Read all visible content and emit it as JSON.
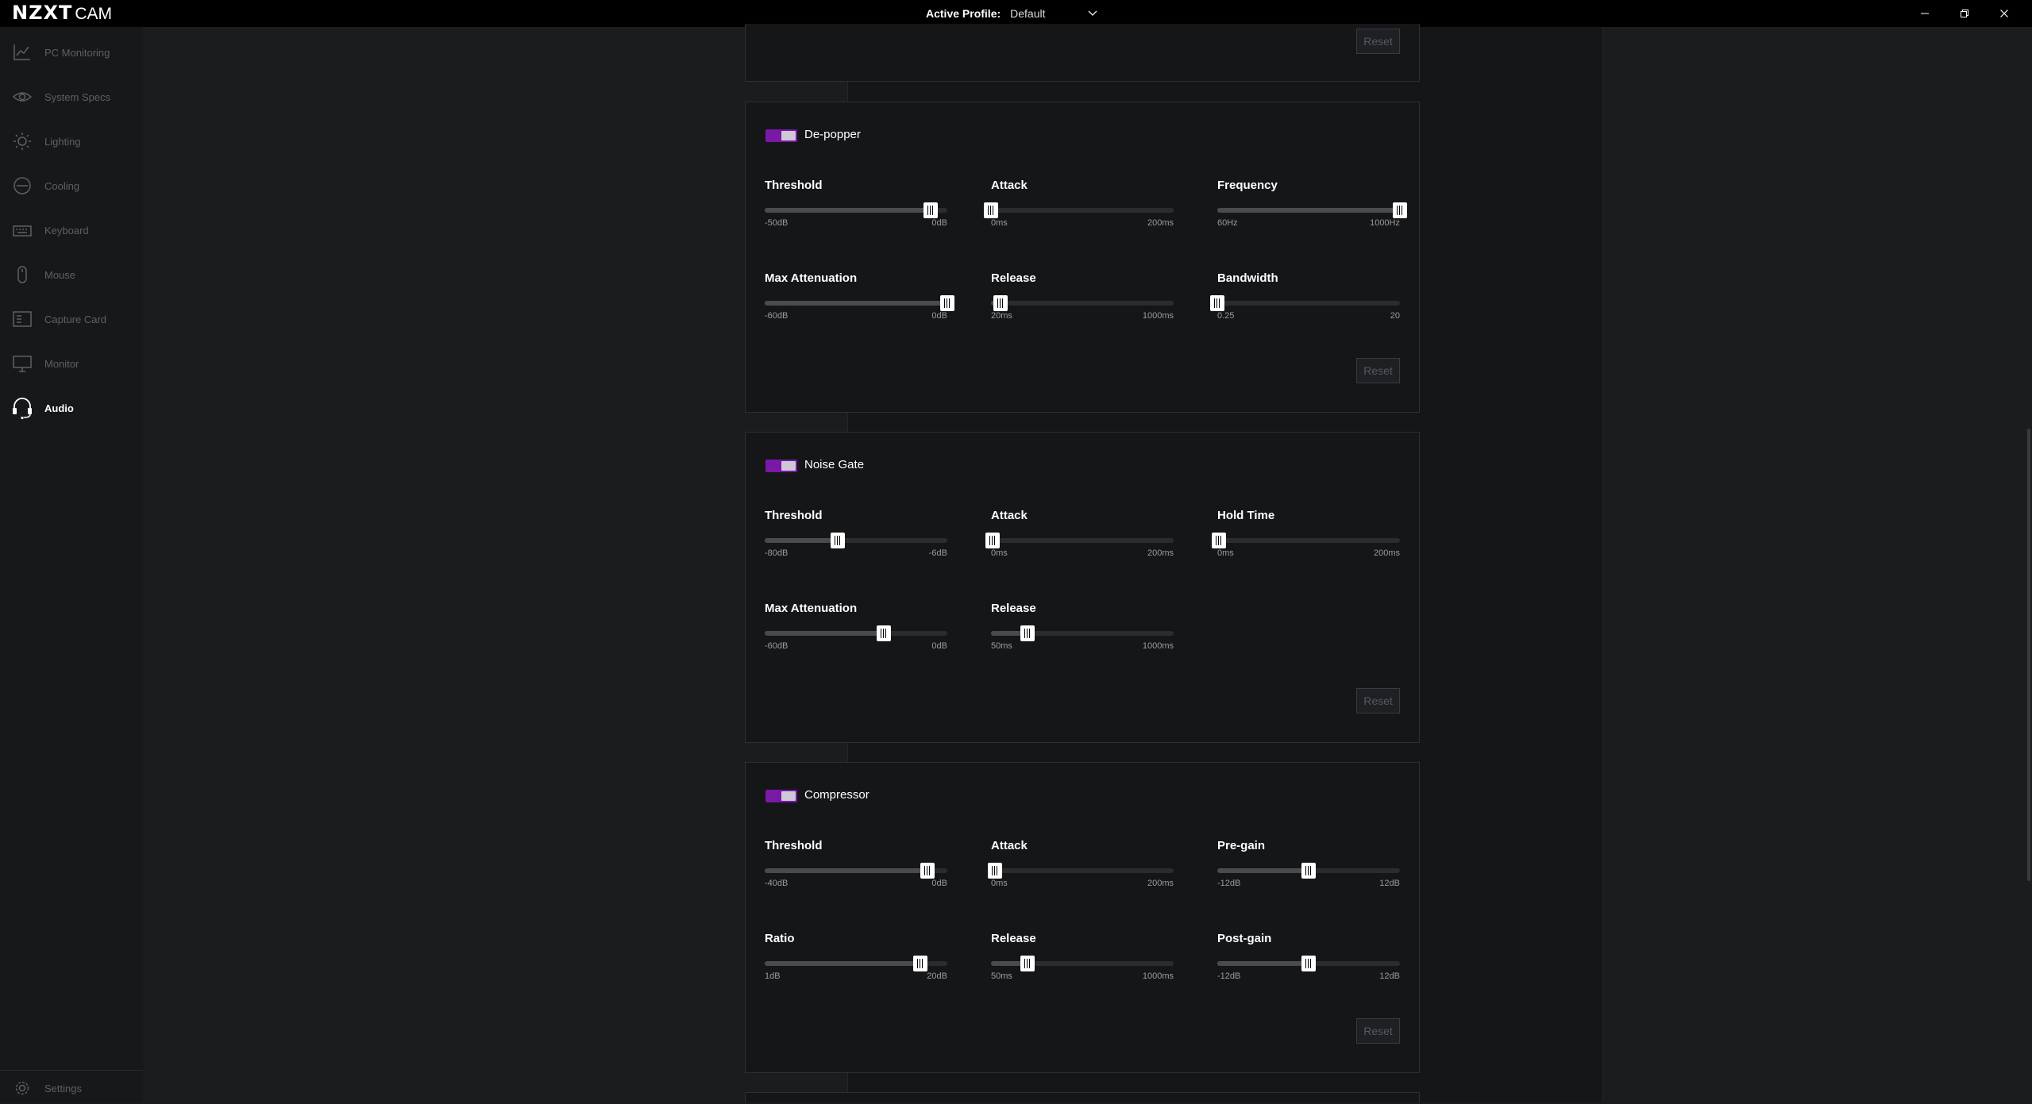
{
  "app": {
    "brand_main": "NZXT",
    "brand_sub": "CAM"
  },
  "profile": {
    "label": "Active Profile:",
    "value": "Default"
  },
  "sidebar": {
    "items": [
      {
        "label": "PC Monitoring",
        "icon": "chart-line-icon"
      },
      {
        "label": "System Specs",
        "icon": "eye-icon"
      },
      {
        "label": "Lighting",
        "icon": "sun-icon"
      },
      {
        "label": "Cooling",
        "icon": "fan-icon"
      },
      {
        "label": "Keyboard",
        "icon": "keyboard-icon"
      },
      {
        "label": "Mouse",
        "icon": "mouse-icon"
      },
      {
        "label": "Capture Card",
        "icon": "capture-card-icon"
      },
      {
        "label": "Monitor",
        "icon": "monitor-icon"
      },
      {
        "label": "Audio",
        "icon": "headset-icon"
      }
    ],
    "active": "Audio",
    "settings_label": "Settings"
  },
  "reset_label": "Reset",
  "colors": {
    "accent": "#7a18a8",
    "knob": "#cfc9d6",
    "background": "#151618"
  },
  "cards": {
    "depopper": {
      "title": "De-popper",
      "enabled": true,
      "sliders": [
        {
          "label": "Threshold",
          "min": "-50dB",
          "max": "0dB",
          "fraction": 0.91
        },
        {
          "label": "Attack",
          "min": "0ms",
          "max": "200ms",
          "fraction": 0.0
        },
        {
          "label": "Frequency",
          "min": "60Hz",
          "max": "1000Hz",
          "fraction": 1.0
        },
        {
          "label": "Max Attenuation",
          "min": "-60dB",
          "max": "0dB",
          "fraction": 1.0
        },
        {
          "label": "Release",
          "min": "20ms",
          "max": "1000ms",
          "fraction": 0.05
        },
        {
          "label": "Bandwidth",
          "min": "0.25",
          "max": "20",
          "fraction": 0.0
        }
      ]
    },
    "noisegate": {
      "title": "Noise Gate",
      "enabled": true,
      "sliders": [
        {
          "label": "Threshold",
          "min": "-80dB",
          "max": "-6dB",
          "fraction": 0.4
        },
        {
          "label": "Attack",
          "min": "0ms",
          "max": "200ms",
          "fraction": 0.01
        },
        {
          "label": "Hold Time",
          "min": "0ms",
          "max": "200ms",
          "fraction": 0.01
        },
        {
          "label": "Max Attenuation",
          "min": "-60dB",
          "max": "0dB",
          "fraction": 0.65
        },
        {
          "label": "Release",
          "min": "50ms",
          "max": "1000ms",
          "fraction": 0.2
        }
      ]
    },
    "compressor": {
      "title": "Compressor",
      "enabled": true,
      "sliders": [
        {
          "label": "Threshold",
          "min": "-40dB",
          "max": "0dB",
          "fraction": 0.89
        },
        {
          "label": "Attack",
          "min": "0ms",
          "max": "200ms",
          "fraction": 0.02
        },
        {
          "label": "Pre-gain",
          "min": "-12dB",
          "max": "12dB",
          "fraction": 0.5
        },
        {
          "label": "Ratio",
          "min": "1dB",
          "max": "20dB",
          "fraction": 0.85
        },
        {
          "label": "Release",
          "min": "50ms",
          "max": "1000ms",
          "fraction": 0.2
        },
        {
          "label": "Post-gain",
          "min": "-12dB",
          "max": "12dB",
          "fraction": 0.5
        }
      ]
    }
  }
}
